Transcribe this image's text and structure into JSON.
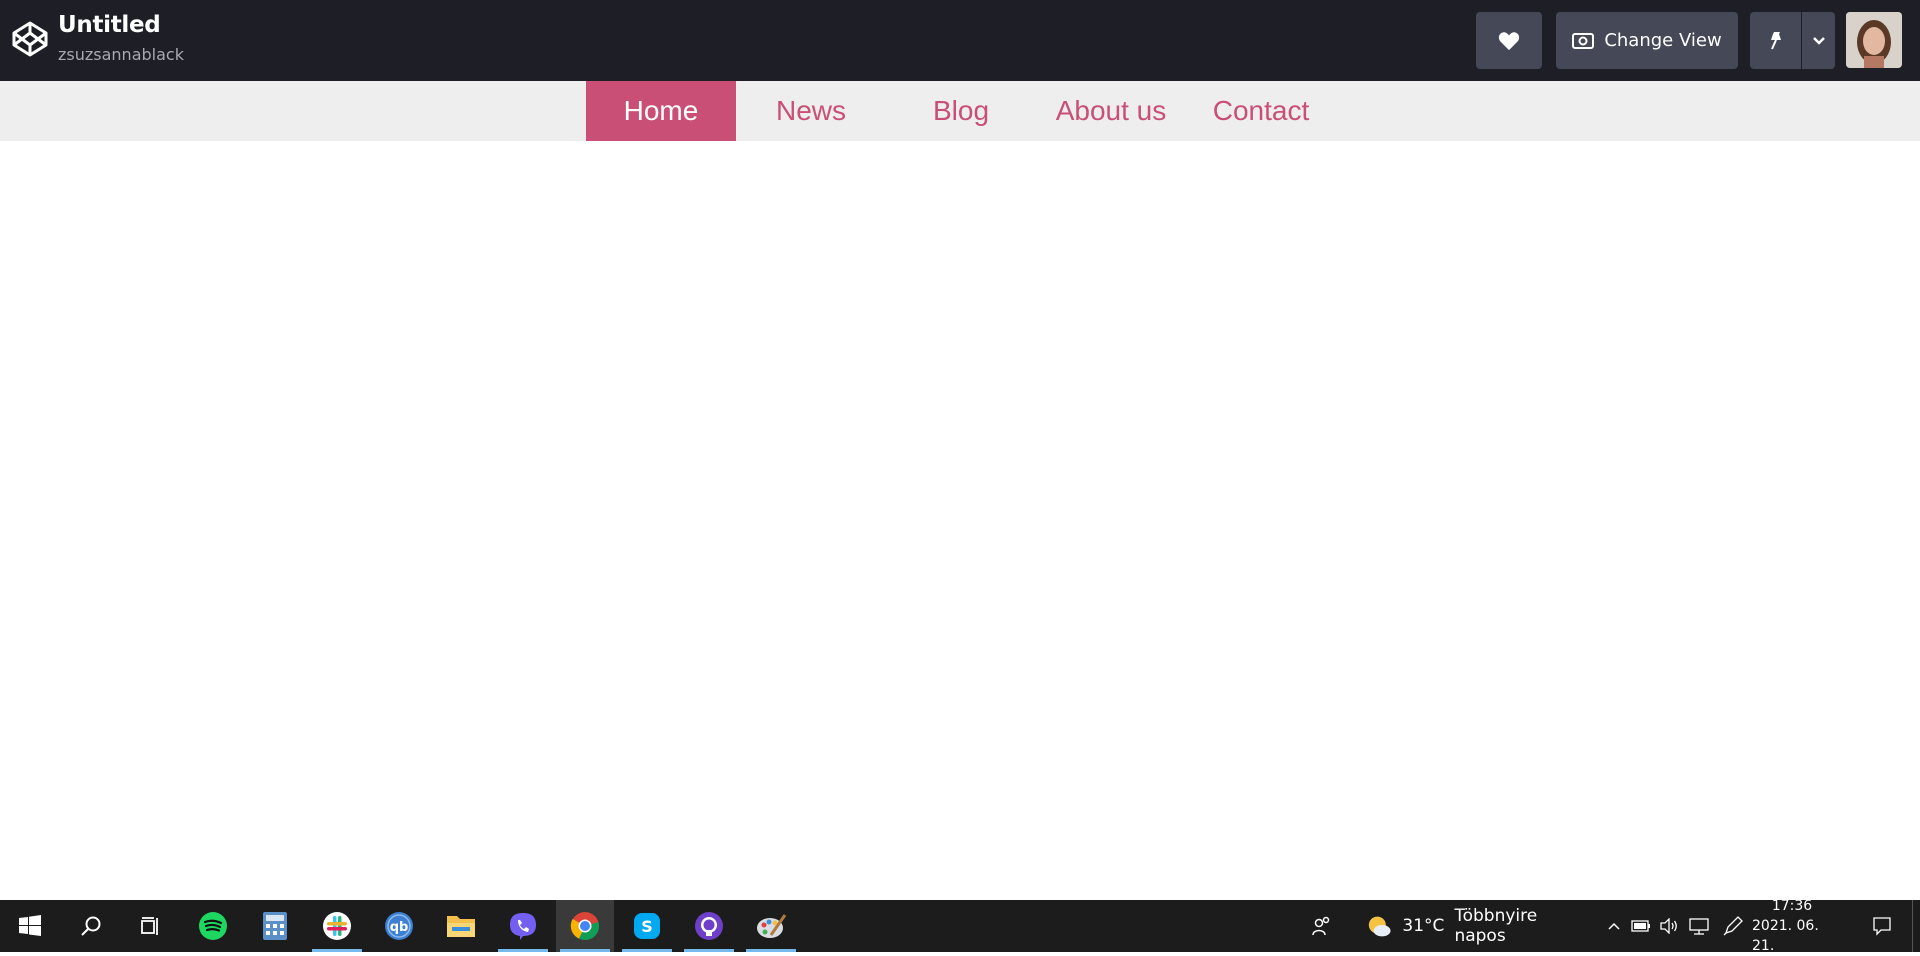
{
  "pen": {
    "title": "Untitled",
    "author": "zsuzsannablack",
    "change_view_label": "Change View"
  },
  "nav": {
    "items": [
      {
        "label": "Home"
      },
      {
        "label": "News"
      },
      {
        "label": "Blog"
      },
      {
        "label": "About us"
      },
      {
        "label": "Contact"
      }
    ],
    "active_color": "#c94f77"
  },
  "taskbar": {
    "weather_temp": "31°C",
    "weather_text": "Többnyire napos",
    "time": "17:36",
    "date": "2021. 06. 21."
  },
  "icons": {
    "logo": "codepen-logo-icon",
    "heart": "heart-icon",
    "view": "eye-icon",
    "pin": "pin-icon",
    "caret": "chevron-down-icon"
  }
}
